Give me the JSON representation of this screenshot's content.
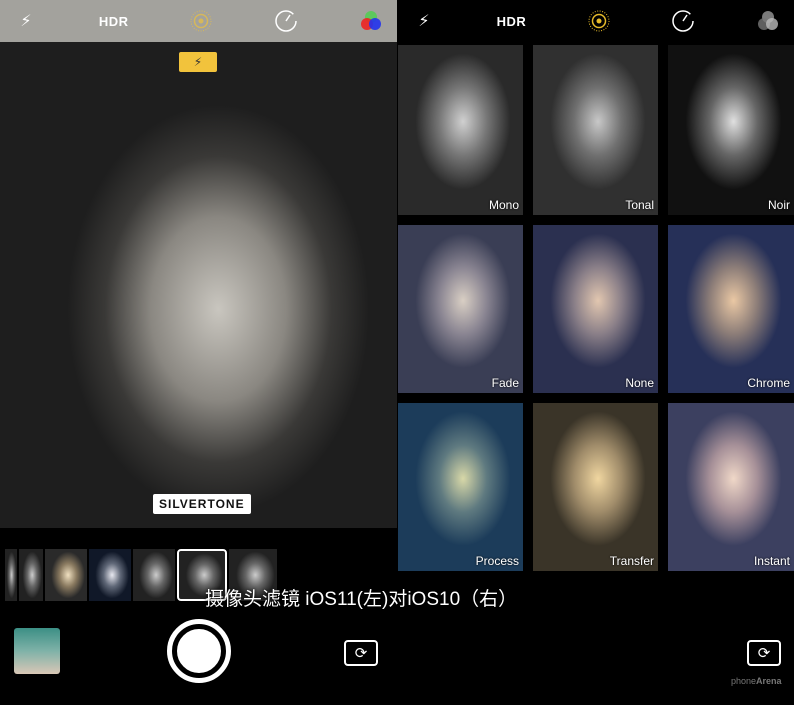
{
  "left": {
    "topbar": {
      "hdr": "HDR",
      "icons": [
        "flash-icon",
        "live-photo-icon",
        "timer-icon",
        "filters-icon"
      ]
    },
    "flash_indicator": "flash-on-icon",
    "filter_label": "SILVERTONE",
    "filter_count": 6
  },
  "right": {
    "topbar": {
      "hdr": "HDR"
    },
    "filters": [
      {
        "name": "Mono",
        "c": [
          "#d0d0d0",
          "#777",
          "#2a2a2a"
        ]
      },
      {
        "name": "Tonal",
        "c": [
          "#c8c8c8",
          "#707070",
          "#303030"
        ]
      },
      {
        "name": "Noir",
        "c": [
          "#e0e0e0",
          "#666",
          "#111"
        ]
      },
      {
        "name": "Fade",
        "c": [
          "#d9cfc4",
          "#8a8592",
          "#3a3e55"
        ]
      },
      {
        "name": "None",
        "c": [
          "#e2c7b0",
          "#8a7f88",
          "#2b3050"
        ]
      },
      {
        "name": "Chrome",
        "c": [
          "#eac8a4",
          "#8c7d78",
          "#263058"
        ]
      },
      {
        "name": "Process",
        "c": [
          "#d8d8a8",
          "#5f7a80",
          "#1c3c5a"
        ]
      },
      {
        "name": "Transfer",
        "c": [
          "#f0d6a0",
          "#a08c6a",
          "#3a3428"
        ]
      },
      {
        "name": "Instant",
        "c": [
          "#f0d8c8",
          "#a69098",
          "#3c4060"
        ]
      }
    ]
  },
  "caption": "摄像头滤镜 iOS11(左)对iOS10（右）",
  "watermark": "phoneArena"
}
